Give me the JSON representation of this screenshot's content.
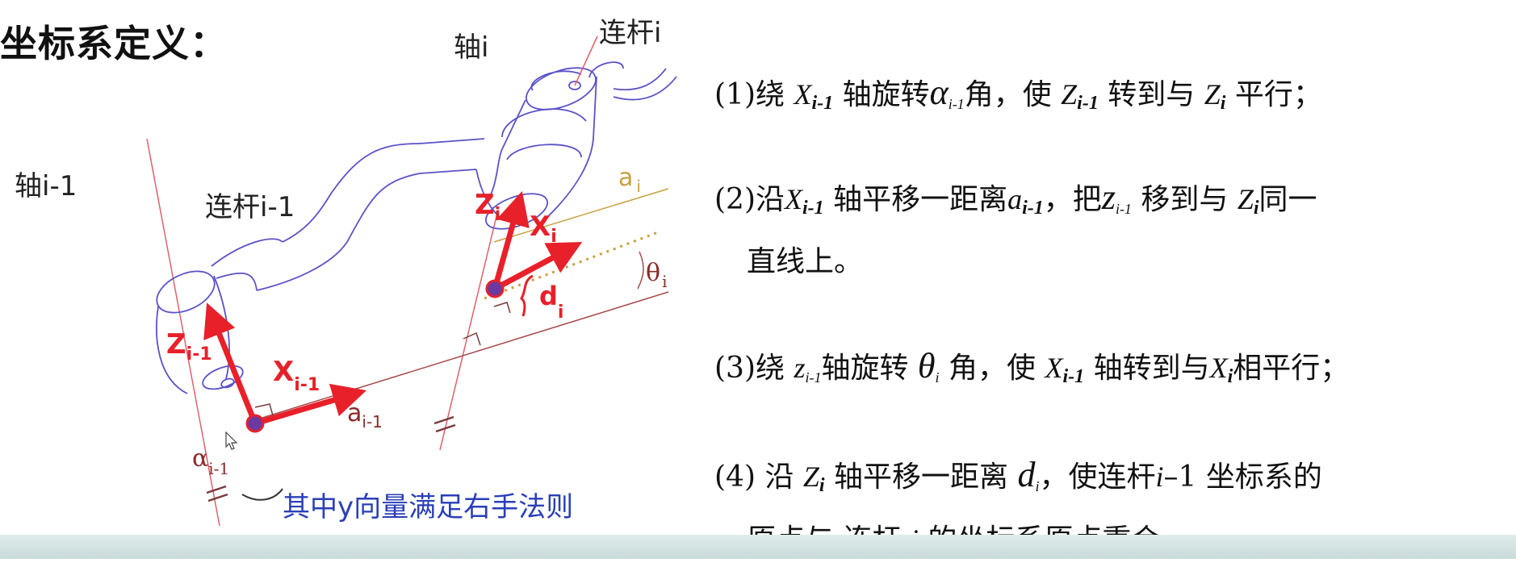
{
  "title": "坐标系定义：",
  "diagram": {
    "axis_i": "轴i",
    "link_i": "连杆i",
    "axis_i_minus_1": "轴i-1",
    "link_i_minus_1": "连杆i-1",
    "z_i": "Z",
    "z_i_sub": "i",
    "x_i": "X",
    "x_i_sub": "i",
    "a_i": "a",
    "a_i_sub": "i",
    "theta_i": "θ",
    "theta_i_sub": "i",
    "d_i": "d",
    "d_i_sub": "i",
    "z_im1": "Z",
    "z_im1_sub": "i-1",
    "x_im1": "X",
    "x_im1_sub": "i-1",
    "a_im1": "a",
    "a_im1_sub": "i-1",
    "alpha_im1": "α",
    "alpha_im1_sub": "i-1",
    "note": "其中y向量满足右手法则"
  },
  "steps": {
    "s1": {
      "num": "(1)绕 ",
      "X": "X",
      "Xsub": "i-1",
      "t1": " 轴旋转",
      "alpha": "α",
      "alphasub": "i-1",
      "t2": "角，使 ",
      "Z1": "Z",
      "Z1sub": "i-1",
      "t3": " 转到与 ",
      "Z2": "Z",
      "Z2sub": "i",
      "t4": " 平行；"
    },
    "s2": {
      "num": "(2)沿",
      "X": "X",
      "Xsub": "i-1",
      "t1": " 轴平移一距离",
      "a": "a",
      "asub": "i-1",
      "t2": "，把",
      "z": "z",
      "zsub": "i-1",
      "t3": " 移到与 ",
      "Z": "Z",
      "Zsub": "i",
      "t4": "同一",
      "line2": "直线上。"
    },
    "s3": {
      "num": "(3)绕 ",
      "z": "z",
      "zsub": "i-1",
      "t1": "轴旋转 ",
      "theta": "θ",
      "thetasub": "i",
      "t2": " 角，使 ",
      "X1": "X",
      "X1sub": "i-1",
      "t3": " 轴转到与",
      "X2": "X",
      "X2sub": "i",
      "t4": "相平行；"
    },
    "s4": {
      "num": "(4) 沿 ",
      "Z": "Z",
      "Zsub": "i",
      "t1": " 轴平移一距离 ",
      "d": "d",
      "dsub": "i",
      "t2": "，使连杆",
      "i1": "i",
      "t3": "–1 坐标系的",
      "line2a": "原点与 连杆 ",
      "i2": "i",
      "line2b": " 的坐标系原点重合。"
    }
  },
  "colors": {
    "frame_red": "#e8202a",
    "link_blue": "#5a52c8",
    "axis_red": "#e0606a",
    "label_darkred": "#8a2a2a",
    "gold": "#c9a040",
    "note_blue": "#2a3fb8",
    "origin_fill": "#6a3aa0"
  }
}
